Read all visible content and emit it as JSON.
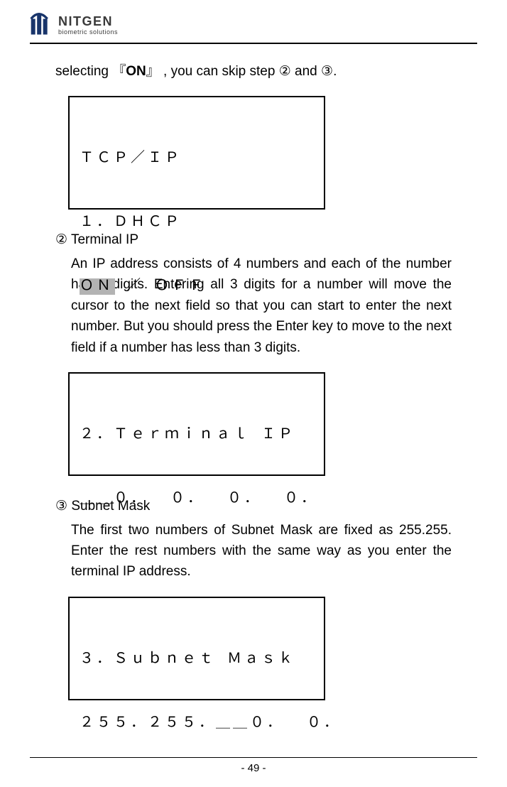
{
  "brand": {
    "name": "NITGEN",
    "tag": "biometric solutions"
  },
  "intro": {
    "pre": "selecting  『",
    "on": "ON",
    "post1": "』 , you can skip step ",
    "circ2": "②",
    "and": " and ",
    "circ3": "③",
    "dot": "."
  },
  "lcd1": {
    "l1": "ＴＣＰ／ＩＰ",
    "l2": "１．ＤＨＣＰ",
    "l3_on": "ＯＮ",
    "l3_rest": " ／ ＯＦＦ"
  },
  "sec2": {
    "num": "②",
    "title": " Terminal IP",
    "body": "An IP address consists of 4 numbers and each of the number has 3 digits. Entering all 3 digits for a number will move the cursor to the next field so that you can start to enter the next number. But you should press the Enter key to move to the next field if a number has less than 3 digits."
  },
  "lcd2": {
    "l1": "２．Ｔｅｒｍｉｎａｌ ＩＰ",
    "l2": "＿＿０．  ０．  ０．  ０．"
  },
  "sec3": {
    "num": "③",
    "title": " Subnet Mask",
    "body": "The first two numbers of Subnet Mask are fixed as 255.255. Enter the rest numbers with the same way as you enter the terminal IP address."
  },
  "lcd3": {
    "l1": "３．Ｓｕｂｎｅｔ Ｍａｓｋ",
    "l2": "２５５．２５５．＿＿０．  ０．"
  },
  "pagenum": "- 49 -"
}
